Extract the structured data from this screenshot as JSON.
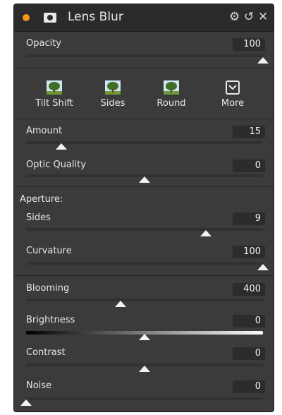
{
  "panel": {
    "title": "Lens Blur"
  },
  "icons": {
    "status_dot": "orange-dot-icon",
    "mask": "mask-icon",
    "settings": "gear-icon",
    "reset": "undo-icon",
    "close": "close-icon"
  },
  "glyphs": {
    "gear": "⚙",
    "reset": "↺",
    "close": "✕"
  },
  "opacity": {
    "label": "Opacity",
    "value": "100",
    "fraction": 1.0
  },
  "presets": [
    {
      "label": "Tilt Shift"
    },
    {
      "label": "Sides"
    },
    {
      "label": "Round"
    }
  ],
  "more": {
    "label": "More"
  },
  "amount": {
    "label": "Amount",
    "value": "15",
    "fraction": 0.15
  },
  "optic_quality": {
    "label": "Optic Quality",
    "value": "0",
    "fraction": 0.5
  },
  "aperture": {
    "heading": "Aperture:",
    "sides": {
      "label": "Sides",
      "value": "9",
      "fraction": 0.76
    },
    "curvature": {
      "label": "Curvature",
      "value": "100",
      "fraction": 1.0
    }
  },
  "blooming": {
    "label": "Blooming",
    "value": "400",
    "fraction": 0.4
  },
  "brightness": {
    "label": "Brightness",
    "value": "0",
    "fraction": 0.5
  },
  "contrast": {
    "label": "Contrast",
    "value": "0",
    "fraction": 0.5
  },
  "noise": {
    "label": "Noise",
    "value": "0",
    "fraction": 0.0
  },
  "colors": {
    "accent": "#f7931e",
    "panel": "#3b3b3b",
    "titlebar": "#2b2b2b"
  }
}
